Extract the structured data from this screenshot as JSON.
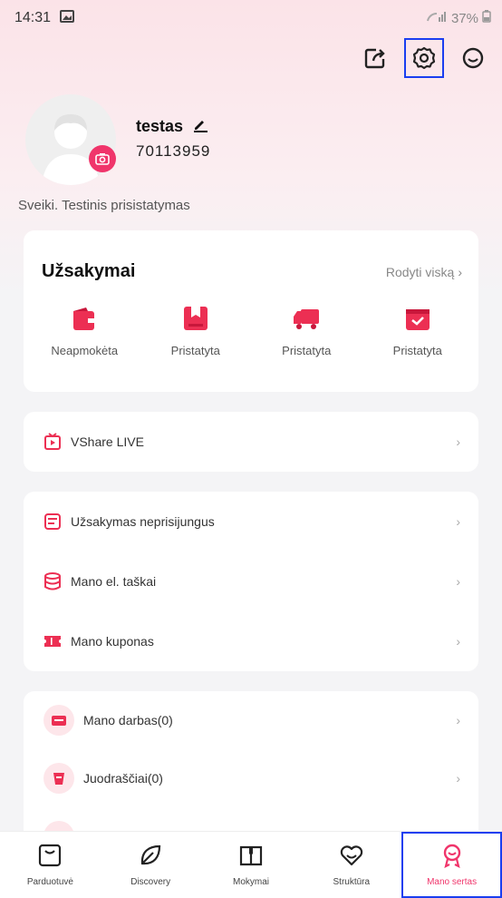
{
  "status_bar": {
    "time": "14:31",
    "battery": "37%"
  },
  "profile": {
    "name": "testas",
    "user_id": "70113959",
    "greeting": "Sveiki. Testinis prisistatymas"
  },
  "orders": {
    "title": "Užsakymai",
    "view_all": "Rodyti viską",
    "items": [
      {
        "label": "Neapmokėta",
        "icon": "wallet-icon"
      },
      {
        "label": "Pristatyta",
        "icon": "bookmark-box-icon"
      },
      {
        "label": "Pristatyta",
        "icon": "truck-icon"
      },
      {
        "label": "Pristatyta",
        "icon": "box-check-icon"
      }
    ]
  },
  "live": {
    "label": "VShare LIVE"
  },
  "menu": {
    "items": [
      {
        "label": "Užsakymas neprisijungus"
      },
      {
        "label": "Mano el. taškai"
      },
      {
        "label": "Mano kuponas"
      }
    ]
  },
  "extra": {
    "items": [
      {
        "label": "Mano darbas(0)"
      },
      {
        "label": "Juodraščiai(0)"
      }
    ]
  },
  "tabs": [
    {
      "label": "Parduotuvė",
      "icon": "store-icon"
    },
    {
      "label": "Discovery",
      "icon": "leaf-icon"
    },
    {
      "label": "Mokymai",
      "icon": "book-icon"
    },
    {
      "label": "Struktūra",
      "icon": "heart-icon"
    },
    {
      "label": "Mano sertas",
      "icon": "medal-icon"
    }
  ],
  "colors": {
    "accent": "#f0356b",
    "highlight": "#1a3ef0"
  }
}
